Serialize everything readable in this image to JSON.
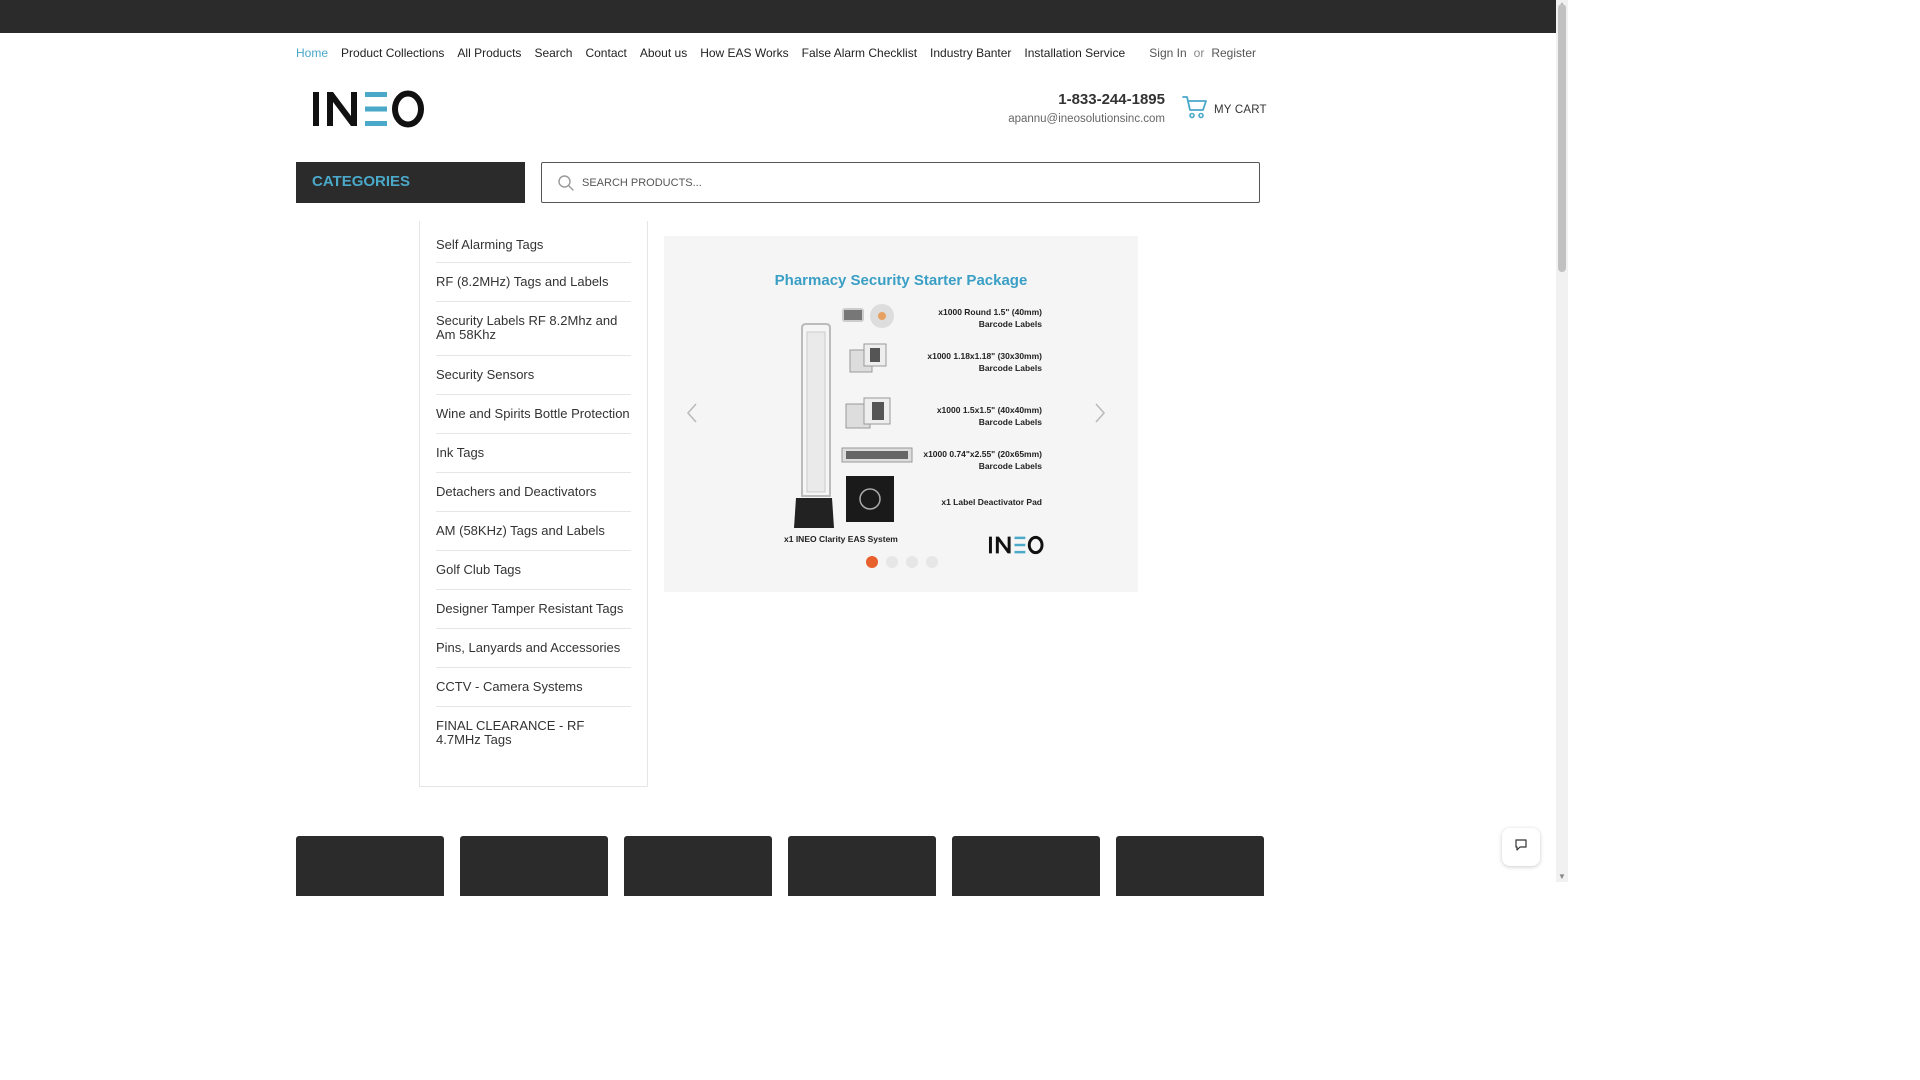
{
  "nav": {
    "items": [
      "Home",
      "Product Collections",
      "All Products",
      "Search",
      "Contact",
      "About us",
      "How EAS Works",
      "False Alarm Checklist",
      "Industry Banter",
      "Installation Service"
    ],
    "active_color": "#4aa8c9"
  },
  "account": {
    "sign_in": "Sign In",
    "or": "or",
    "register": "Register"
  },
  "header": {
    "phone": "1-833-244-1895",
    "email": "apannu@ineosolutionsinc.com",
    "cart_label": "MY CART",
    "logo_text": "INEO"
  },
  "categories": {
    "title": "CATEGORIES",
    "items": [
      "Self Alarming Tags",
      "RF (8.2MHz) Tags and Labels",
      "Security Labels RF 8.2Mhz and Am 58Khz",
      "Security Sensors",
      "Wine and Spirits Bottle Protection",
      "Ink Tags",
      "Detachers and Deactivators",
      "AM (58KHz) Tags and Labels",
      "Golf Club Tags",
      "Designer Tamper Resistant Tags",
      "Pins, Lanyards and Accessories",
      "CCTV - Camera Systems",
      "FINAL CLEARANCE - RF 4.7MHz Tags"
    ]
  },
  "search": {
    "placeholder": "SEARCH PRODUCTS..."
  },
  "slider": {
    "title": "Pharmacy Security Starter Package",
    "lines": [
      "x1000 Round 1.5\" (40mm) Barcode Labels",
      "x1000 1.18x1.18\" (30x30mm) Barcode Labels",
      "x1000 1.5x1.5\" (40x40mm) Barcode Labels",
      "x1000 0.74\"x2.55\" (20x65mm) Barcode Labels",
      "x1 Label Deactivator Pad"
    ],
    "gate_caption": "x1 INEO Clarity EAS System",
    "slide_count": 4,
    "active_slide": 1
  },
  "colors": {
    "dark": "#2b2b2b",
    "accent": "#4aa8c9",
    "dot_active": "#e8602c"
  }
}
